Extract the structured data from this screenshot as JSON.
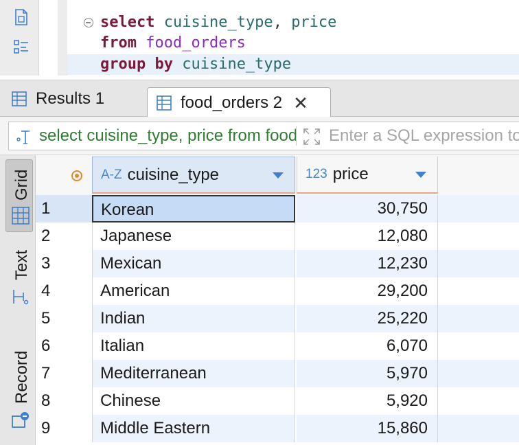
{
  "editor": {
    "lines": [
      {
        "kw": "select",
        "rest_id": "cuisine_type",
        "comma": ",",
        "rest_id2": "price"
      },
      {
        "kw": "from",
        "table": "food_orders"
      },
      {
        "kw": "group by",
        "rest_id": "cuisine_type"
      }
    ]
  },
  "tabs": [
    {
      "label": "Results 1",
      "active": false,
      "icon": "table-icon"
    },
    {
      "label": "food_orders 2",
      "active": true,
      "icon": "table-icon",
      "close": "✕"
    }
  ],
  "filter": {
    "query_text": "select cuisine_type, price from food_orders group by cuisine_type",
    "placeholder": "Enter a SQL expression to filter results (use Ctrl+Space)"
  },
  "side_panel": {
    "items": [
      {
        "label": "Grid",
        "icon": "grid-icon",
        "active": true
      },
      {
        "label": "Text",
        "icon": "text-icon",
        "active": false
      },
      {
        "label": "Record",
        "icon": "record-icon",
        "active": false
      }
    ]
  },
  "grid": {
    "columns": [
      {
        "type_icon": "A-Z",
        "label": "cuisine_type"
      },
      {
        "type_icon": "123",
        "label": "price"
      }
    ],
    "rows": [
      {
        "num": "1",
        "cuisine_type": "Korean",
        "price": "30,750"
      },
      {
        "num": "2",
        "cuisine_type": "Japanese",
        "price": "12,080"
      },
      {
        "num": "3",
        "cuisine_type": "Mexican",
        "price": "12,230"
      },
      {
        "num": "4",
        "cuisine_type": "American",
        "price": "29,200"
      },
      {
        "num": "5",
        "cuisine_type": "Indian",
        "price": "25,220"
      },
      {
        "num": "6",
        "cuisine_type": "Italian",
        "price": "6,070"
      },
      {
        "num": "7",
        "cuisine_type": "Mediterranean",
        "price": "5,970"
      },
      {
        "num": "8",
        "cuisine_type": "Chinese",
        "price": "5,920"
      },
      {
        "num": "9",
        "cuisine_type": "Middle Eastern",
        "price": "15,860"
      }
    ],
    "selected_row": 1
  },
  "colors": {
    "keyword": "#7b1a38",
    "identifier": "#2a6b6b",
    "table": "#8b2bbd",
    "filter_text": "#2e7d32",
    "accent": "#3f7fd0"
  }
}
